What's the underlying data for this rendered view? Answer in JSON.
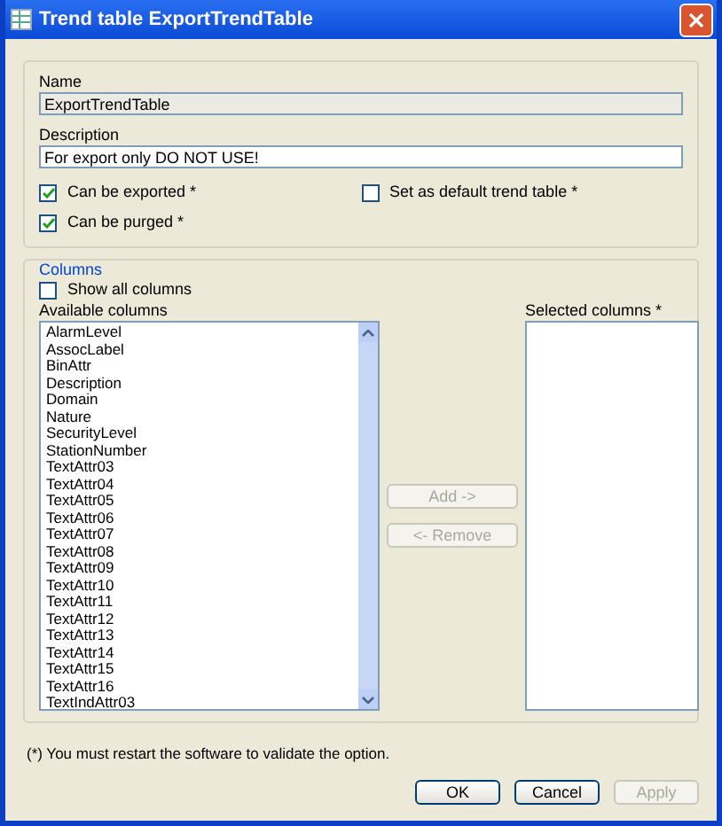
{
  "window": {
    "title": "Trend table ExportTrendTable"
  },
  "name": {
    "label": "Name",
    "value": "ExportTrendTable",
    "disabled": true
  },
  "description": {
    "label": "Description",
    "value": "For export only DO NOT USE!"
  },
  "options": [
    {
      "label": "Can be exported *",
      "checked": true
    },
    {
      "label": "Set as default trend table *",
      "checked": false
    },
    {
      "label": "Can be purged *",
      "checked": true
    }
  ],
  "columns": {
    "title": "Columns",
    "show_all": {
      "label": "Show all columns",
      "checked": false
    },
    "available_label": "Available columns",
    "available": [
      "AlarmLevel",
      "AssocLabel",
      "BinAttr",
      "Description",
      "Domain",
      "Nature",
      "SecurityLevel",
      "StationNumber",
      "TextAttr03",
      "TextAttr04",
      "TextAttr05",
      "TextAttr06",
      "TextAttr07",
      "TextAttr08",
      "TextAttr09",
      "TextAttr10",
      "TextAttr11",
      "TextAttr12",
      "TextAttr13",
      "TextAttr14",
      "TextAttr15",
      "TextAttr16",
      "TextIndAttr03"
    ],
    "move_buttons": [
      {
        "label": "Add ->",
        "disabled": true
      },
      {
        "label": "<- Remove",
        "disabled": true
      }
    ],
    "selected_label": "Selected columns *"
  },
  "footnote": "(*) You must restart the software to validate the option.",
  "buttons": [
    {
      "label": "OK",
      "disabled": false
    },
    {
      "label": "Cancel",
      "disabled": false
    },
    {
      "label": "Apply",
      "disabled": true
    }
  ]
}
